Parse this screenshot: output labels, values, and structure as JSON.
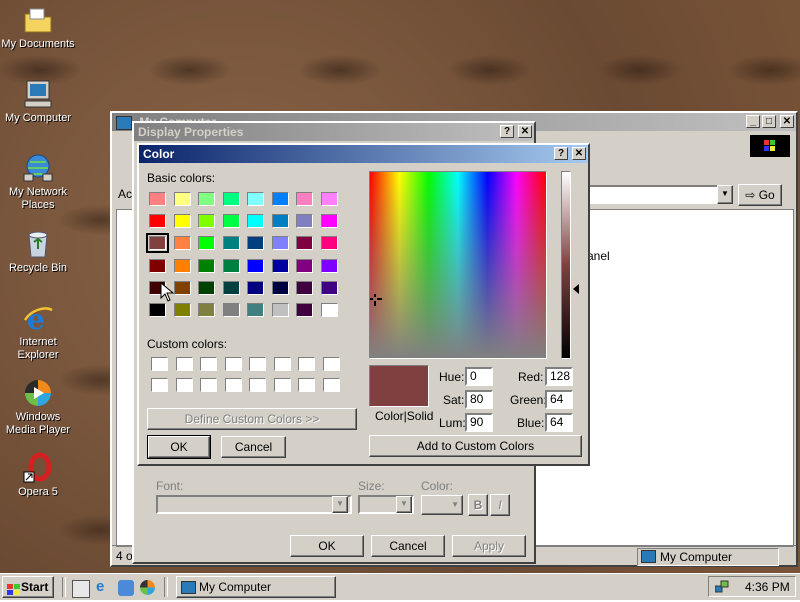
{
  "desktop": {
    "icons": [
      {
        "label": "My Documents",
        "icon": "folder-documents-icon"
      },
      {
        "label": "My Computer",
        "icon": "computer-icon"
      },
      {
        "label": "My Network Places",
        "icon": "network-icon"
      },
      {
        "label": "Recycle Bin",
        "icon": "recycle-bin-icon"
      },
      {
        "label": "Internet Explorer",
        "icon": "internet-explorer-icon"
      },
      {
        "label": "Windows Media Player",
        "icon": "media-player-icon"
      },
      {
        "label": "Opera 5",
        "icon": "opera-icon"
      }
    ]
  },
  "my_computer": {
    "title": "My Computer",
    "address_label": "Ac",
    "go_label": "Go",
    "panel_text": "anel",
    "status_left": "4 o",
    "status_right": "My Computer"
  },
  "display_properties": {
    "title": "Display Properties",
    "font_label": "Font:",
    "size_label": "Size:",
    "color_label": "Color:",
    "bold_label": "B",
    "italic_label": "I",
    "ok_label": "OK",
    "cancel_label": "Cancel",
    "apply_label": "Apply"
  },
  "color_dialog": {
    "title": "Color",
    "basic_colors_label": "Basic colors:",
    "custom_colors_label": "Custom colors:",
    "define_custom_label": "Define Custom Colors >>",
    "ok_label": "OK",
    "cancel_label": "Cancel",
    "add_custom_label": "Add to Custom Colors",
    "color_solid_label": "Color|Solid",
    "hue_label": "Hue:",
    "sat_label": "Sat:",
    "lum_label": "Lum:",
    "red_label": "Red:",
    "green_label": "Green:",
    "blue_label": "Blue:",
    "hue": "0",
    "sat": "80",
    "lum": "90",
    "red": "128",
    "green": "64",
    "blue": "64",
    "selected_color": "#804040",
    "basic_colors": [
      [
        "#ff8080",
        "#ffff80",
        "#80ff80",
        "#00ff80",
        "#80ffff",
        "#0080ff",
        "#ff80c0",
        "#ff80ff"
      ],
      [
        "#ff0000",
        "#ffff00",
        "#80ff00",
        "#00ff40",
        "#00ffff",
        "#0080c0",
        "#8080c0",
        "#ff00ff"
      ],
      [
        "#804040",
        "#ff8040",
        "#00ff00",
        "#008080",
        "#004080",
        "#8080ff",
        "#800040",
        "#ff0080"
      ],
      [
        "#800000",
        "#ff8000",
        "#008000",
        "#008040",
        "#0000ff",
        "#0000a0",
        "#800080",
        "#8000ff"
      ],
      [
        "#400000",
        "#804000",
        "#004000",
        "#004040",
        "#000080",
        "#000040",
        "#400040",
        "#400080"
      ],
      [
        "#000000",
        "#808000",
        "#808040",
        "#808080",
        "#408080",
        "#c0c0c0",
        "#400040",
        "#ffffff"
      ]
    ],
    "selected_index": [
      2,
      0
    ]
  },
  "taskbar": {
    "start_label": "Start",
    "task_label": "My Computer",
    "clock": "4:36 PM"
  }
}
